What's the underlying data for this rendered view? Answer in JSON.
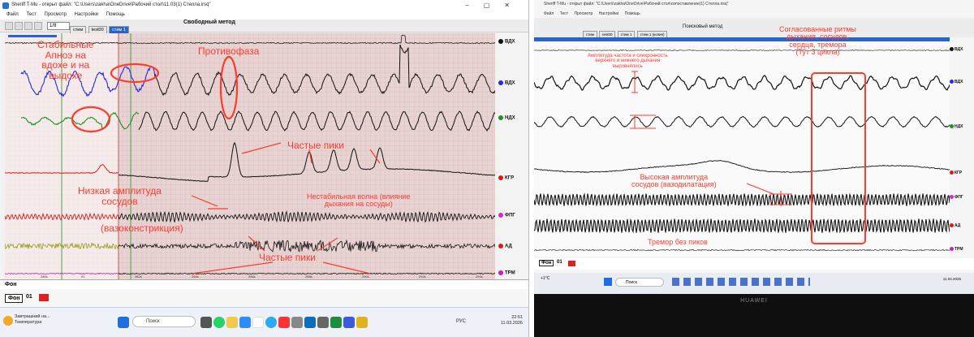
{
  "left": {
    "window_title": "Sheriff T-Mu - открыт файл: \"C:\\Users\\zakha\\OneDrive\\Рабочий стол\\11.03(1) Стелла.irsq\"",
    "menu": [
      "Файл",
      "Тест",
      "Просмотр",
      "Настройки",
      "Помощь"
    ],
    "zoom_value": "1/8",
    "method_title": "Свободный метод",
    "tabs": [
      "стим",
      "test00",
      "стим 1"
    ],
    "channels": [
      "ВДХ",
      "ВДХ",
      "НДХ",
      "КГР",
      "ФПГ",
      "АД",
      "ТРМ"
    ],
    "annotations": {
      "stable": "Стабильные\nАпноэ на\nвдохе и на\nвыдохе",
      "antiphase": "Противофаза",
      "frequent_peaks": "Частые пики",
      "low_amp": "Низкая амплитуда\nсосудов",
      "vasoconstriction": "(вазоконстрикция)",
      "unstable_wave": "Нестабильная волна (влияние\nдыхания на сосуды)",
      "frequent_peaks_2": "Частые пики"
    },
    "phase_label": "Фон",
    "phase_box": "Фон",
    "phase_number": "01",
    "taskbar": {
      "weather_title": "Завтрашний на...",
      "weather_sub": "Температура",
      "search": "Поиск",
      "lang": "РУС",
      "time": "22:51",
      "date": "11.03.2026"
    }
  },
  "right": {
    "window_title": "Sheriff T-Mu - открыт файл: \"C:\\Users\\zakha\\OneDrive\\Рабочий стол\\сопоставление(1) Стелла.irsq\"",
    "menu": [
      "Файл",
      "Тест",
      "Просмотр",
      "Настройки",
      "Помощь"
    ],
    "method_title": "Поисковый метод",
    "tabs": [
      "стим",
      "test00",
      "стим 1",
      "стим 1 (копия)"
    ],
    "channels": [
      "ВДХ",
      "ВДХ",
      "НДХ",
      "КГР",
      "ФПГ",
      "АД",
      "ТРМ"
    ],
    "annotations": {
      "amplitude": "Амплитуда частота и синхронность\nверхнего и нижнего дыхания\nвыровнялись",
      "coordinated": "Согласованные ритмы\nдыхания, сосудов,\nсердца, тремора\n(Тут 3 цикла)",
      "high_amp": "Высокая амплитуда\nсосудов (вазодилатация)",
      "tremor": "Тремор без пиков"
    },
    "phase_box": "Фон",
    "phase_number": "01",
    "search": "Поиск",
    "temp": "+1°C",
    "date": "11.04.2026",
    "brand": "HUAWEI"
  },
  "colors": {
    "annotation": "#ff3b30",
    "chart_bg_left": "#e8d3d3",
    "blue_trace": "#2a2ad6",
    "green_trace": "#1f8f1f",
    "red_trace": "#d81b1b",
    "olive_trace": "#9a9a1a",
    "magenta_trace": "#c020c0"
  }
}
